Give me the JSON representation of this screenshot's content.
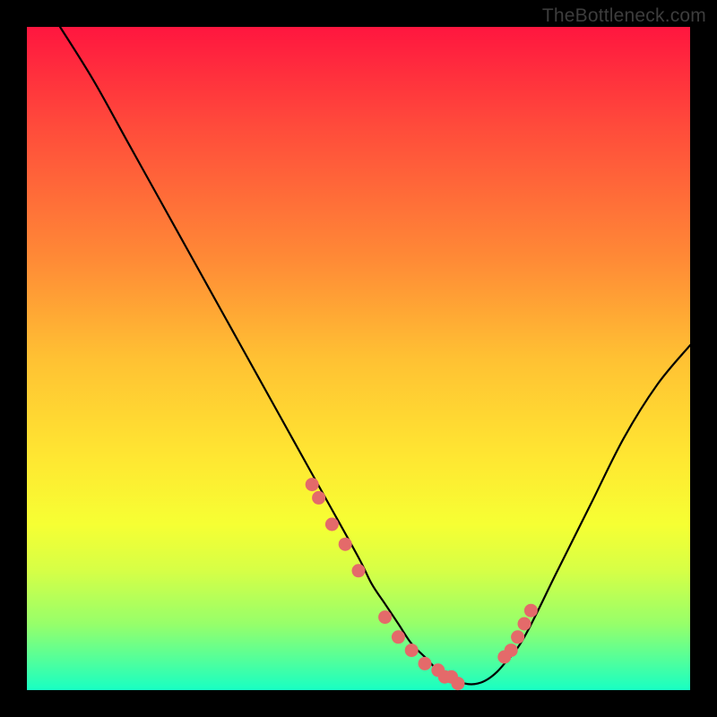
{
  "watermark": "TheBottleneck.com",
  "chart_data": {
    "type": "line",
    "title": "",
    "xlabel": "",
    "ylabel": "",
    "xlim": [
      0,
      100
    ],
    "ylim": [
      0,
      100
    ],
    "grid": false,
    "series": [
      {
        "name": "bottleneck-curve",
        "x": [
          5,
          10,
          15,
          20,
          25,
          30,
          35,
          40,
          45,
          50,
          52,
          54,
          56,
          58,
          60,
          62,
          64,
          66,
          68,
          70,
          72,
          75,
          80,
          85,
          90,
          95,
          100
        ],
        "y": [
          100,
          92,
          83,
          74,
          65,
          56,
          47,
          38,
          29,
          20,
          16,
          13,
          10,
          7,
          5,
          3,
          2,
          1,
          1,
          2,
          4,
          8,
          18,
          28,
          38,
          46,
          52
        ]
      }
    ],
    "markers": {
      "name": "highlighted-points",
      "color": "#e46a6a",
      "x": [
        43,
        44,
        46,
        48,
        50,
        54,
        56,
        58,
        60,
        62,
        63,
        64,
        65,
        72,
        73,
        74,
        75,
        76
      ],
      "y": [
        31,
        29,
        25,
        22,
        18,
        11,
        8,
        6,
        4,
        3,
        2,
        2,
        1,
        5,
        6,
        8,
        10,
        12
      ]
    }
  }
}
